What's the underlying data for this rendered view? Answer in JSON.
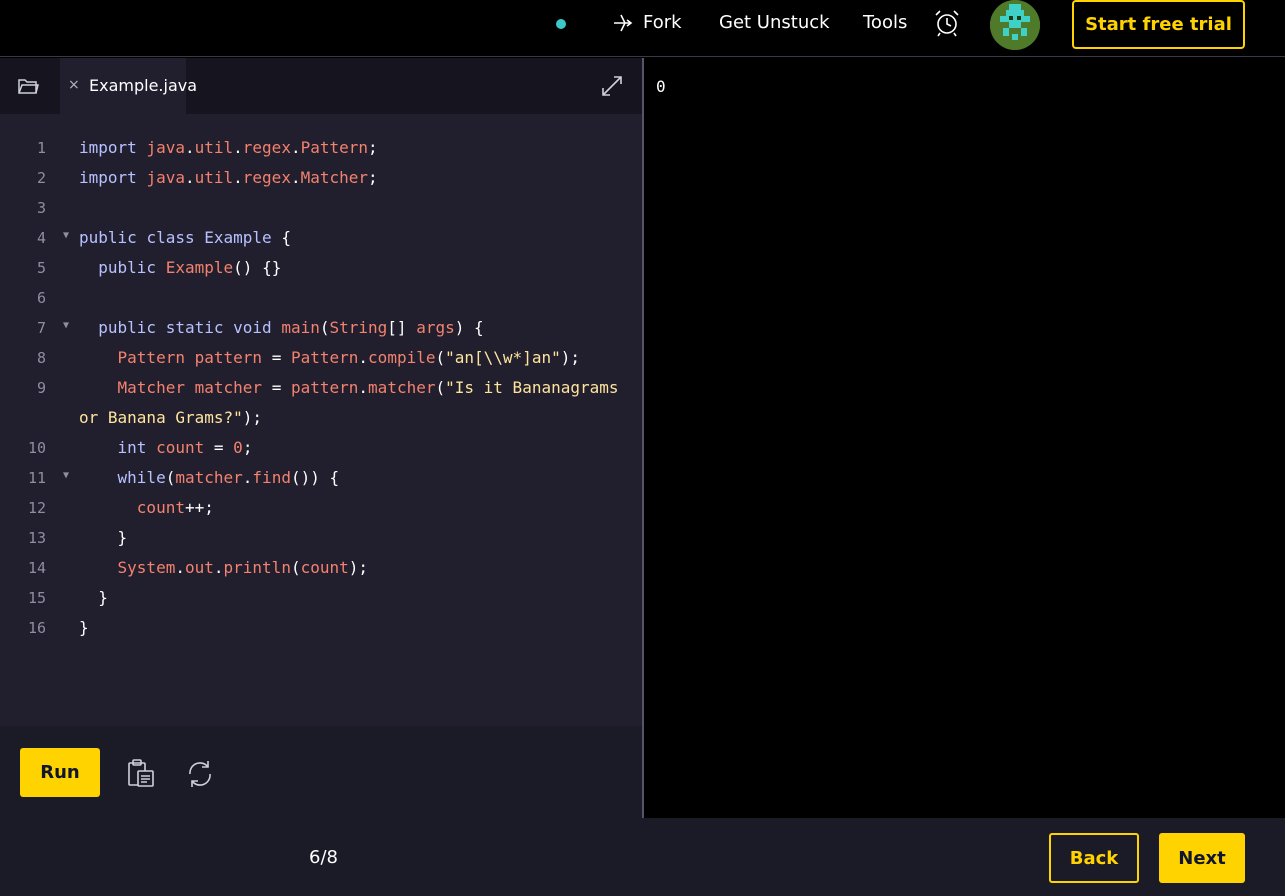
{
  "header": {
    "fork_label": "Fork",
    "unstuck_label": "Get Unstuck",
    "tools_label": "Tools",
    "trial_label": "Start free trial",
    "icons": [
      "status-dot",
      "fork-icon",
      "alarm-clock-icon",
      "avatar"
    ]
  },
  "editor": {
    "file_name": "Example.java",
    "close_glyph": "×",
    "lines": [
      {
        "n": "1",
        "fold": "",
        "code": "import java.util.regex.Pattern;"
      },
      {
        "n": "2",
        "fold": "",
        "code": "import java.util.regex.Matcher;"
      },
      {
        "n": "3",
        "fold": "",
        "code": ""
      },
      {
        "n": "4",
        "fold": "▼",
        "code": "public class Example {"
      },
      {
        "n": "5",
        "fold": "",
        "code": "  public Example() {}"
      },
      {
        "n": "6",
        "fold": "",
        "code": ""
      },
      {
        "n": "7",
        "fold": "▼",
        "code": "  public static void main(String[] args) {"
      },
      {
        "n": "8",
        "fold": "",
        "code": "    Pattern pattern = Pattern.compile(\"an[\\\\w*]an\");"
      },
      {
        "n": "9",
        "fold": "",
        "code": "    Matcher matcher = pattern.matcher(\"Is it Bananagrams"
      },
      {
        "n": "",
        "fold": "",
        "code": "or Banana Grams?\");"
      },
      {
        "n": "10",
        "fold": "",
        "code": "    int count = 0;"
      },
      {
        "n": "11",
        "fold": "▼",
        "code": "    while(matcher.find()) {"
      },
      {
        "n": "12",
        "fold": "",
        "code": "      count++;"
      },
      {
        "n": "13",
        "fold": "",
        "code": "    }"
      },
      {
        "n": "14",
        "fold": "",
        "code": "    System.out.println(count);"
      },
      {
        "n": "15",
        "fold": "",
        "code": "  }"
      },
      {
        "n": "16",
        "fold": "",
        "code": "}"
      }
    ],
    "run_label": "Run"
  },
  "output": {
    "text": "0"
  },
  "footer": {
    "progress": "6/8",
    "back_label": "Back",
    "next_label": "Next"
  },
  "colors": {
    "accent": "#ffd300",
    "editor_bg": "#211f2e",
    "keyword": "#b7c1ff",
    "identifier": "#f3826e",
    "string": "#ffe49e"
  }
}
